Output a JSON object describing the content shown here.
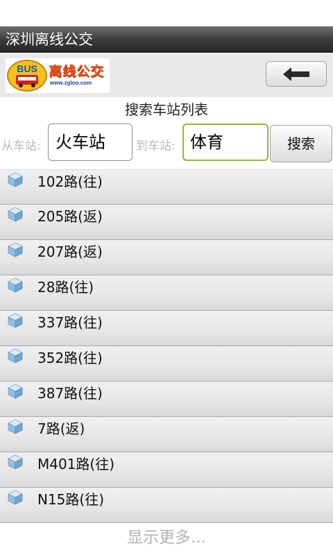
{
  "app": {
    "window_title": "深圳离线公交"
  },
  "header": {
    "logo_bus": "BUS",
    "logo_name": "离线公交",
    "logo_url": "www.zgloo.com",
    "back_icon": "arrow-left-icon"
  },
  "search": {
    "list_title": "搜索车站列表",
    "from_label": "从车站:",
    "from_value": "火车站",
    "to_label": "到车站:",
    "to_value": "体育",
    "button_label": "搜索"
  },
  "results": [
    {
      "label": "102路(往)",
      "icon": "cube-icon"
    },
    {
      "label": "205路(返)",
      "icon": "cube-icon"
    },
    {
      "label": "207路(返)",
      "icon": "cube-icon"
    },
    {
      "label": "28路(往)",
      "icon": "cube-icon"
    },
    {
      "label": "337路(往)",
      "icon": "cube-icon"
    },
    {
      "label": "352路(往)",
      "icon": "cube-icon"
    },
    {
      "label": "387路(往)",
      "icon": "cube-icon"
    },
    {
      "label": "7路(返)",
      "icon": "cube-icon"
    },
    {
      "label": "M401路(往)",
      "icon": "cube-icon"
    },
    {
      "label": "N15路(往)",
      "icon": "cube-icon"
    }
  ],
  "footer": {
    "show_more": "显示更多..."
  },
  "colors": {
    "title_bar": "#3a3a3a",
    "focus_border": "#8dbb35",
    "logo_text": "#e8511c",
    "hint_text": "#b8b8b8"
  }
}
